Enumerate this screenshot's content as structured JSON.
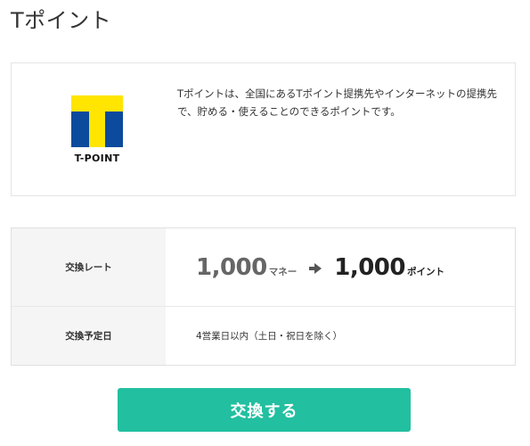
{
  "page": {
    "title": "Tポイント"
  },
  "info": {
    "logo_text": "T-POINT",
    "description": "Tポイントは、全国にあるTポイント提携先やインターネットの提携先で、貯める・使えることのできるポイントです。"
  },
  "logo_colors": {
    "yellow": "#ffe500",
    "blue": "#0b4a9c"
  },
  "exchange": {
    "rate_label": "交換レート",
    "money_amount": "1,000",
    "money_unit": "マネー",
    "arrow_icon": "arrow-right-icon",
    "point_amount": "1,000",
    "point_unit": "ポイント",
    "schedule_label": "交換予定日",
    "schedule_value": "4営業日以内（土日・祝日を除く）"
  },
  "button": {
    "label": "交換する",
    "color": "#22bfa0"
  }
}
